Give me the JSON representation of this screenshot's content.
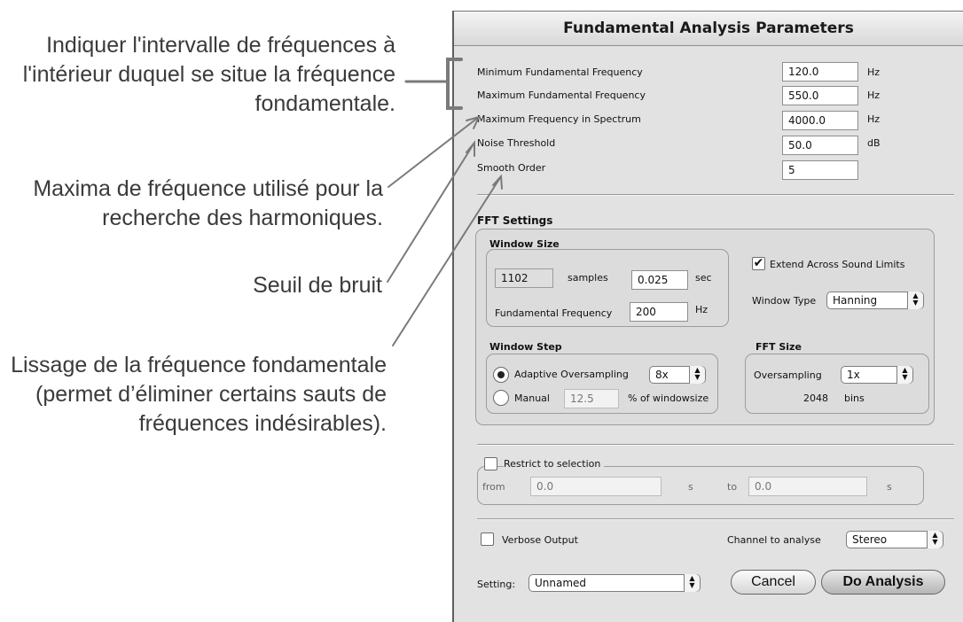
{
  "annotations": {
    "frequency_range": [
      "Indiquer l'intervalle de fréquences à",
      "l'intérieur duquel se situe la fréquence",
      "fondamentale."
    ],
    "max_frequency": [
      "Maxima de fréquence utilisé pour la",
      "recherche des harmoniques."
    ],
    "noise_threshold": [
      "Seuil de bruit"
    ],
    "smoothing": [
      "Lissage de la fréquence fondamentale",
      "(permet d’éliminer certains sauts de",
      "fréquences indésirables)."
    ]
  },
  "dialog": {
    "title": "Fundamental Analysis Parameters",
    "params": [
      {
        "label": "Minimum Fundamental Frequency",
        "value": "120.0",
        "unit": "Hz"
      },
      {
        "label": "Maximum Fundamental Frequency",
        "value": "550.0",
        "unit": "Hz"
      },
      {
        "label": "Maximum Frequency in Spectrum",
        "value": "4000.0",
        "unit": "Hz"
      },
      {
        "label": "Noise Threshold",
        "value": "50.0",
        "unit": "dB"
      },
      {
        "label": "Smooth Order",
        "value": "5",
        "unit": ""
      }
    ],
    "fft": {
      "title": "FFT Settings",
      "window_size": {
        "title": "Window Size",
        "samples_value": "1102",
        "samples_label": "samples",
        "sec_value": "0.025",
        "sec_label": "sec",
        "fund_freq_label": "Fundamental Frequency",
        "fund_freq_value": "200",
        "fund_freq_unit": "Hz"
      },
      "extend_label": "Extend Across Sound Limits",
      "extend_checked": true,
      "window_type_label": "Window Type",
      "window_type_value": "Hanning",
      "window_step": {
        "title": "Window Step",
        "adaptive_label": "Adaptive Oversampling",
        "adaptive_value": "8x",
        "manual_label": "Manual",
        "manual_value": "12.5",
        "manual_unit": "% of windowsize",
        "selected": "adaptive"
      },
      "fft_size": {
        "title": "FFT Size",
        "oversampling_label": "Oversampling",
        "oversampling_value": "1x",
        "bins_value": "2048",
        "bins_label": "bins"
      }
    },
    "restrict": {
      "label": "Restrict to selection",
      "from_label": "from",
      "from_value": "0.0",
      "from_unit": "s",
      "to_label": "to",
      "to_value": "0.0",
      "to_unit": "s"
    },
    "verbose_label": "Verbose Output",
    "channel_label": "Channel to analyse",
    "channel_value": "Stereo",
    "setting_label": "Setting:",
    "setting_value": "Unnamed",
    "cancel_label": "Cancel",
    "do_analysis_label": "Do Analysis"
  },
  "icons": {
    "popup_arrows": "updown-arrows-icon",
    "check": "checkmark-icon"
  },
  "colors": {
    "dialog_bg": "#e2e2e2",
    "annotation_text": "#3a3a3a",
    "connector": "#7a7a7a"
  }
}
